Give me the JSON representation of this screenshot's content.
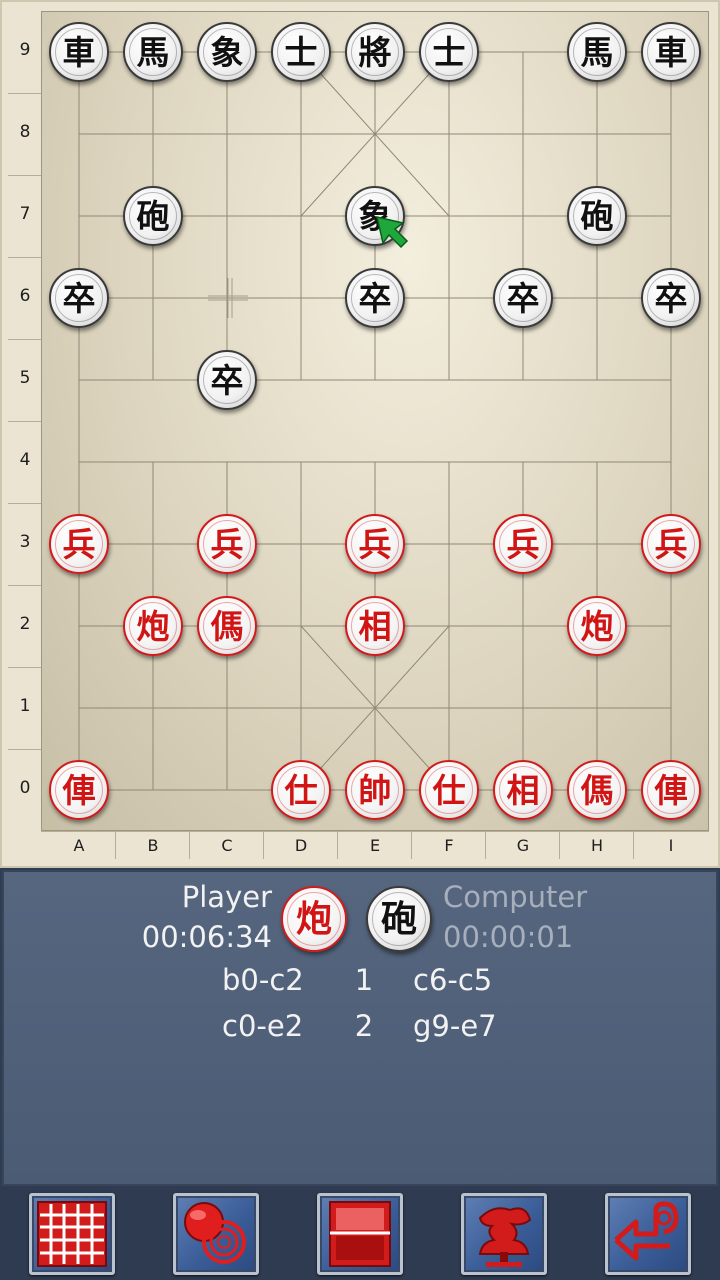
{
  "board": {
    "ranks": [
      "9",
      "8",
      "7",
      "6",
      "5",
      "4",
      "3",
      "2",
      "1",
      "0"
    ],
    "files": [
      "A",
      "B",
      "C",
      "D",
      "E",
      "F",
      "G",
      "H",
      "I"
    ]
  },
  "pieces": [
    {
      "f": 0,
      "r": 9,
      "c": "black",
      "ch": "車"
    },
    {
      "f": 1,
      "r": 9,
      "c": "black",
      "ch": "馬"
    },
    {
      "f": 2,
      "r": 9,
      "c": "black",
      "ch": "象"
    },
    {
      "f": 3,
      "r": 9,
      "c": "black",
      "ch": "士"
    },
    {
      "f": 4,
      "r": 9,
      "c": "black",
      "ch": "將"
    },
    {
      "f": 5,
      "r": 9,
      "c": "black",
      "ch": "士"
    },
    {
      "f": 7,
      "r": 9,
      "c": "black",
      "ch": "馬"
    },
    {
      "f": 8,
      "r": 9,
      "c": "black",
      "ch": "車"
    },
    {
      "f": 1,
      "r": 7,
      "c": "black",
      "ch": "砲"
    },
    {
      "f": 4,
      "r": 7,
      "c": "black",
      "ch": "象"
    },
    {
      "f": 7,
      "r": 7,
      "c": "black",
      "ch": "砲"
    },
    {
      "f": 0,
      "r": 6,
      "c": "black",
      "ch": "卒"
    },
    {
      "f": 4,
      "r": 6,
      "c": "black",
      "ch": "卒"
    },
    {
      "f": 6,
      "r": 6,
      "c": "black",
      "ch": "卒"
    },
    {
      "f": 8,
      "r": 6,
      "c": "black",
      "ch": "卒"
    },
    {
      "f": 2,
      "r": 5,
      "c": "black",
      "ch": "卒"
    },
    {
      "f": 0,
      "r": 3,
      "c": "red",
      "ch": "兵"
    },
    {
      "f": 2,
      "r": 3,
      "c": "red",
      "ch": "兵"
    },
    {
      "f": 4,
      "r": 3,
      "c": "red",
      "ch": "兵"
    },
    {
      "f": 6,
      "r": 3,
      "c": "red",
      "ch": "兵"
    },
    {
      "f": 8,
      "r": 3,
      "c": "red",
      "ch": "兵"
    },
    {
      "f": 1,
      "r": 2,
      "c": "red",
      "ch": "炮"
    },
    {
      "f": 2,
      "r": 2,
      "c": "red",
      "ch": "傌"
    },
    {
      "f": 4,
      "r": 2,
      "c": "red",
      "ch": "相"
    },
    {
      "f": 7,
      "r": 2,
      "c": "red",
      "ch": "炮"
    },
    {
      "f": 0,
      "r": 0,
      "c": "red",
      "ch": "俥"
    },
    {
      "f": 3,
      "r": 0,
      "c": "red",
      "ch": "仕"
    },
    {
      "f": 4,
      "r": 0,
      "c": "red",
      "ch": "帥"
    },
    {
      "f": 5,
      "r": 0,
      "c": "red",
      "ch": "仕"
    },
    {
      "f": 6,
      "r": 0,
      "c": "red",
      "ch": "相"
    },
    {
      "f": 7,
      "r": 0,
      "c": "red",
      "ch": "傌"
    },
    {
      "f": 8,
      "r": 0,
      "c": "red",
      "ch": "俥"
    }
  ],
  "status": {
    "player_name": "Player",
    "player_time": "00:06:34",
    "player_piece": "炮",
    "computer_name": "Computer",
    "computer_time": "00:00:01",
    "computer_piece": "砲"
  },
  "moves": [
    {
      "num": "1",
      "red": "b0-c2",
      "black": "c6-c5"
    },
    {
      "num": "2",
      "red": "c0-e2",
      "black": "g9-e7"
    }
  ],
  "colors": {
    "red": "#d11414",
    "black": "#111111",
    "panel": "#4e5d76",
    "accent": "#3b5d98"
  },
  "toolbar": [
    {
      "icon": "grid-icon"
    },
    {
      "icon": "pieces-icon"
    },
    {
      "icon": "window-icon"
    },
    {
      "icon": "tree-icon"
    },
    {
      "icon": "undo-arrow-icon"
    }
  ]
}
